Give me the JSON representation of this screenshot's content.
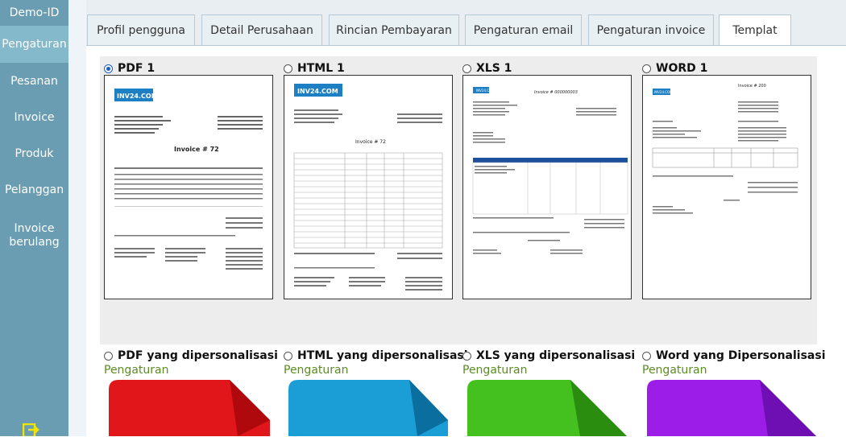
{
  "sidebar": {
    "brand": "Demo-ID",
    "items": [
      {
        "label": "Pengaturan",
        "active": true
      },
      {
        "label": "Pesanan"
      },
      {
        "label": "Invoice"
      },
      {
        "label": "Produk"
      },
      {
        "label": "Pelanggan"
      },
      {
        "label": "Invoice berulang"
      }
    ]
  },
  "tabs": [
    "Profil pengguna",
    "Detail Perusahaan",
    "Rincian Pembayaran",
    "Pengaturan email",
    "Pengaturan invoice",
    "Templat"
  ],
  "active_tab": "Templat",
  "templates": [
    {
      "label": "PDF 1",
      "selected": true,
      "logo": "INV24.COM",
      "invoice_title": "Invoice # 72"
    },
    {
      "label": "HTML 1",
      "selected": false,
      "logo": "INV24.COM",
      "invoice_title": "Invoice # 72"
    },
    {
      "label": "XLS 1",
      "selected": false,
      "logo": "INV24.COM",
      "invoice_title": "Invoice # 000000003"
    },
    {
      "label": "WORD 1",
      "selected": false,
      "logo": "INV24.COM",
      "invoice_title": "Invoice # 200"
    }
  ],
  "custom_templates": [
    {
      "label": "PDF yang dipersonalisasi",
      "settings_link": "Pengaturan",
      "color": "#e0161b",
      "fold": "#b0090d"
    },
    {
      "label": "HTML yang dipersonalisasi",
      "settings_link": "Pengaturan",
      "color": "#1b9ed6",
      "fold": "#0a6f9e"
    },
    {
      "label": "XLS yang dipersonalisasi",
      "settings_link": "Pengaturan",
      "color": "#44c11f",
      "fold": "#2a8d10"
    },
    {
      "label": "Word yang Dipersonalisasi",
      "settings_link": "Pengaturan",
      "color": "#9d1de8",
      "fold": "#6d0fb3"
    }
  ],
  "colors": {
    "sidebar": "#6a9db1",
    "sidebar_active": "#84b8cb",
    "link_green": "#5a8c23",
    "radio_blue": "#1a5fc7"
  }
}
